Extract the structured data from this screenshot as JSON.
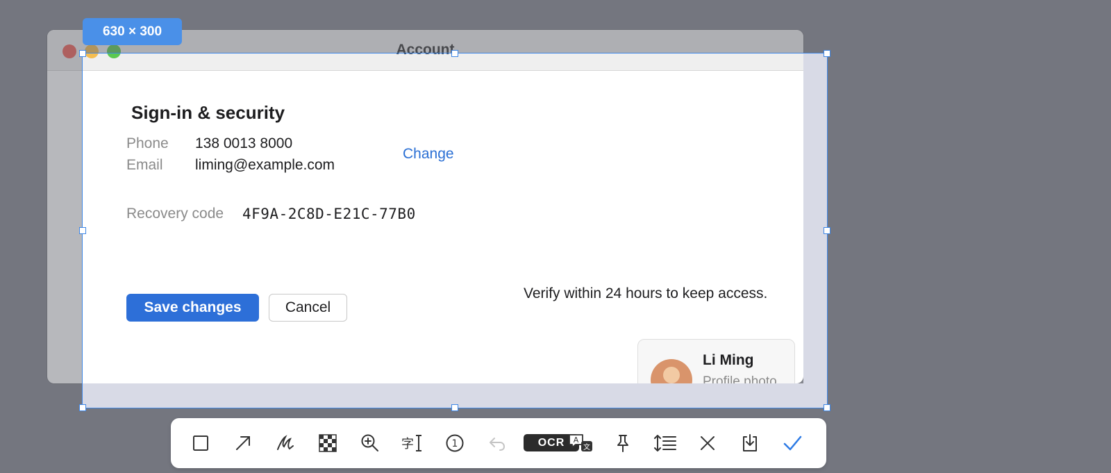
{
  "selection": {
    "size_label": "630 × 300"
  },
  "window": {
    "title": "Account"
  },
  "section": {
    "title": "Sign-in & security",
    "phone_label": "Phone",
    "phone_value": "138 0013 8000",
    "email_label": "Email",
    "email_value": "liming@example.com",
    "change_link": "Change",
    "recovery_label": "Recovery code",
    "recovery_value": "4F9A-2C8D-E21C-77B0"
  },
  "actions": {
    "save": "Save changes",
    "cancel": "Cancel"
  },
  "notice": "Verify within 24 hours to keep access.",
  "profile": {
    "name": "Li Ming",
    "subtitle": "Profile photo"
  },
  "toolbar": {
    "ocr_label": "OCR",
    "step_number": "1",
    "tools": [
      "rectangle-icon",
      "arrow-icon",
      "pen-icon",
      "mosaic-icon",
      "magnifier-icon",
      "text-icon",
      "step-number-icon",
      "undo-icon",
      "ocr-button",
      "translate-icon",
      "pin-icon",
      "long-screenshot-icon",
      "close-icon",
      "save-icon",
      "confirm-icon"
    ]
  },
  "colors": {
    "accent": "#2d6fd8",
    "selection": "#3d86e6",
    "link": "#2a6fd4"
  }
}
